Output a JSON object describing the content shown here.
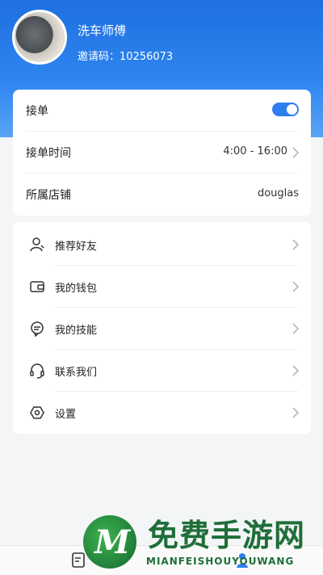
{
  "profile": {
    "name": "洗车师傅",
    "invite_code": "邀请码：10256073"
  },
  "settings": {
    "accept": {
      "label": "接单",
      "enabled": true
    },
    "hours": {
      "label": "接单时间",
      "value": "4:00 - 16:00"
    },
    "store": {
      "label": "所属店铺",
      "value": "douglas"
    }
  },
  "menu": [
    {
      "label": "推荐好友",
      "icon": "person-icon"
    },
    {
      "label": "我的钱包",
      "icon": "wallet-icon"
    },
    {
      "label": "我的技能",
      "icon": "skill-icon"
    },
    {
      "label": "联系我们",
      "icon": "headset-icon"
    },
    {
      "label": "设置",
      "icon": "settings-icon"
    }
  ],
  "watermark": {
    "title": "免费手游网",
    "subtitle": "MIANFEISHOUYOUWANG"
  },
  "colors": {
    "primary": "#2f7ef0",
    "header": "#1f6fe0",
    "watermark": "#1e6e38"
  }
}
